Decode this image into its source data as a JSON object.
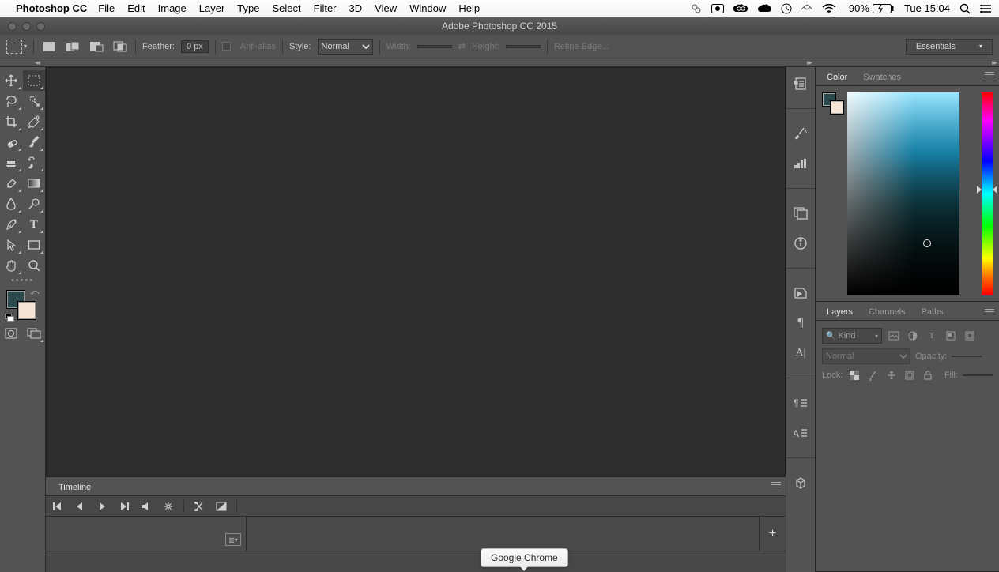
{
  "menubar": {
    "app_name": "Photoshop CC",
    "items": [
      "File",
      "Edit",
      "Image",
      "Layer",
      "Type",
      "Select",
      "Filter",
      "3D",
      "View",
      "Window",
      "Help"
    ],
    "battery_pct": "90%",
    "clock": "Tue 15:04"
  },
  "titlebar": {
    "title": "Adobe Photoshop CC 2015"
  },
  "options_bar": {
    "feather_label": "Feather:",
    "feather_value": "0 px",
    "antialias_label": "Anti-alias",
    "style_label": "Style:",
    "style_value": "Normal",
    "width_label": "Width:",
    "height_label": "Height:",
    "refine_label": "Refine Edge...",
    "workspace": "Essentials"
  },
  "swatches": {
    "fg": "#2a4a4e",
    "bg": "#f6e4d6"
  },
  "panels": {
    "color_tab": "Color",
    "swatches_tab": "Swatches",
    "layers_tab": "Layers",
    "channels_tab": "Channels",
    "paths_tab": "Paths",
    "timeline_tab": "Timeline"
  },
  "layers": {
    "kind_placeholder": "Kind",
    "blend_mode": "Normal",
    "opacity_label": "Opacity:",
    "lock_label": "Lock:",
    "fill_label": "Fill:"
  },
  "dock_tooltip": "Google Chrome"
}
